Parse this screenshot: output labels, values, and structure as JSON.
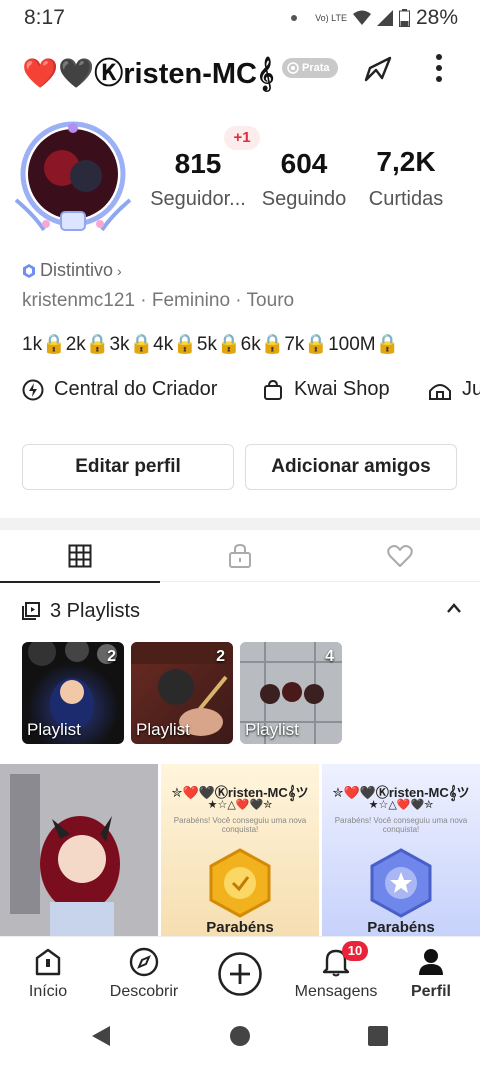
{
  "status_bar": {
    "time": "8:17",
    "network": "Vo) LTE",
    "battery": "28%"
  },
  "profile": {
    "display_name": "❤️🖤Ⓚristen-MC𝄞",
    "level_badge": "Prata",
    "new_followers_badge": "+1",
    "stats": [
      {
        "value": "815",
        "label": "Seguidor..."
      },
      {
        "value": "604",
        "label": "Seguindo"
      },
      {
        "value": "7,2K",
        "label": "Curtidas"
      }
    ],
    "distintivo": "Distintivo",
    "user_info": "kristenmc121 · Feminino · Touro",
    "bio": "1k🔒2k🔒3k🔒4k🔒5k🔒6k🔒7k🔒100M🔒"
  },
  "quick_links": [
    {
      "label": "Central do Criador",
      "icon": "lightning-icon"
    },
    {
      "label": "Kwai Shop",
      "icon": "shopping-bag-icon"
    },
    {
      "label": "Ju",
      "icon": "house-icon"
    }
  ],
  "actions": {
    "edit_profile": "Editar perfil",
    "add_friends": "Adicionar amigos"
  },
  "tabs": [
    {
      "name": "grid",
      "icon": "grid-icon",
      "active": true
    },
    {
      "name": "private",
      "icon": "lock-icon",
      "active": false
    },
    {
      "name": "liked",
      "icon": "heart-icon",
      "active": false
    }
  ],
  "playlists": {
    "header": "3 Playlists",
    "items": [
      {
        "label": "Playlist",
        "count": "2"
      },
      {
        "label": "Playlist",
        "count": "2"
      },
      {
        "label": "Playlist",
        "count": "4"
      }
    ]
  },
  "grid": [
    {
      "type": "video"
    },
    {
      "type": "achievement",
      "title": "✮❤️🖤Ⓚristen-MC𝄞ツ",
      "title2": "★☆△❤️🖤✮",
      "subtitle": "Parabéns! Você conseguiu uma nova conquista!",
      "footer": "Parabéns"
    },
    {
      "type": "achievement",
      "title": "✮❤️🖤Ⓚristen-MC𝄞ツ",
      "title2": "★☆△❤️🖤✮",
      "subtitle": "Parabéns! Você conseguiu uma nova conquista!",
      "footer": "Parabéns"
    }
  ],
  "bottom_nav": [
    {
      "label": "Início",
      "icon": "home-icon"
    },
    {
      "label": "Descobrir",
      "icon": "compass-icon"
    },
    {
      "label": "",
      "icon": "plus-circle-icon"
    },
    {
      "label": "Mensagens",
      "icon": "bell-icon",
      "badge": "10"
    },
    {
      "label": "Perfil",
      "icon": "person-icon",
      "active": true
    }
  ],
  "colors": {
    "accent_red": "#e8233a",
    "badge_grey": "#c9c9c9",
    "text_dark": "#222222"
  }
}
